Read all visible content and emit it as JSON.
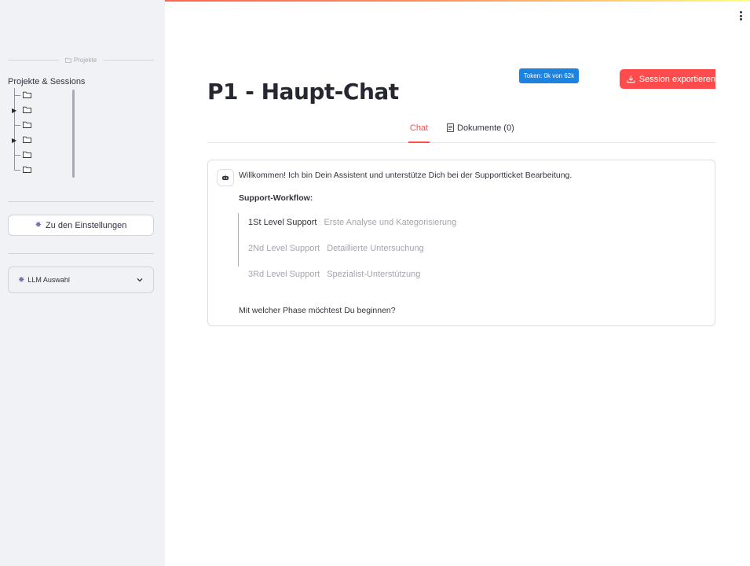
{
  "sidebar": {
    "divider_label": "Projekte",
    "section_title": "Projekte & Sessions",
    "settings_button": "Zu den Einstellungen",
    "llm_expander": "LLM Auswahl"
  },
  "header": {
    "token_badge": "Token: 0k von 62k",
    "export_button": "Session exportieren",
    "title": "P1 - Haupt-Chat"
  },
  "tabs": [
    {
      "label": "Chat",
      "active": true
    },
    {
      "label": "Dokumente (0)",
      "active": false
    }
  ],
  "chat": {
    "welcome": "Willkommen! Ich bin Dein Assistent und unterstütze Dich bei der Supportticket Bearbeitung.",
    "workflow_title": "Support-Workflow:",
    "steps": [
      {
        "name": "1St Level Support",
        "desc": "Erste Analyse und Kategorisierung",
        "active": true
      },
      {
        "name": "2Nd Level Support",
        "desc": "Detaillierte Untersuchung",
        "active": false
      },
      {
        "name": "3Rd Level Support",
        "desc": "Spezialist-Unterstützung",
        "active": false
      }
    ],
    "closing": "Mit welcher Phase möchtest Du beginnen?"
  },
  "colors": {
    "accent": "#ff4b4b",
    "token_badge_bg": "#1c83e1",
    "sidebar_bg": "#f0f2f6"
  }
}
